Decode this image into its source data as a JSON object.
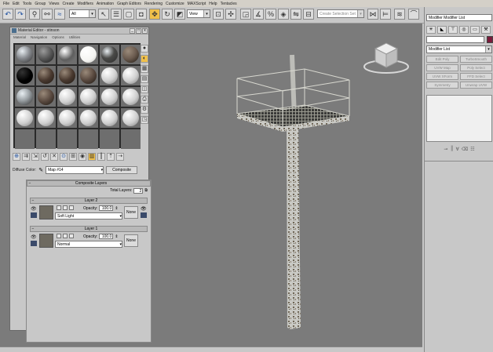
{
  "menubar": {
    "items": [
      "File",
      "Edit",
      "Tools",
      "Group",
      "Views",
      "Create",
      "Modifiers",
      "Animation",
      "Graph Editors",
      "Rendering",
      "Customize",
      "MAXScript",
      "Help",
      "Tentacles"
    ]
  },
  "toolbar": {
    "filter_value": "All",
    "ref_coord_value": "View",
    "selection_set_placeholder": "Create Selection Set",
    "icons": [
      "undo-icon",
      "redo-icon",
      "link-icon",
      "unlink-icon",
      "bind-spacewarp-icon",
      "select-object-icon",
      "select-by-name-icon",
      "rect-selection-icon",
      "window-crossing-icon",
      "move-icon",
      "rotate-icon",
      "scale-icon",
      "pivot-icon",
      "select-manipulate-icon",
      "snaps-icon",
      "angle-snap-icon",
      "percent-snap-icon",
      "spinner-snap-icon",
      "mirror-icon",
      "align-icon",
      "layers-icon",
      "curve-editor-icon"
    ]
  },
  "material_editor": {
    "title": "Material Editor - stinson",
    "menu": [
      "Material",
      "Navigation",
      "Options",
      "Utilities"
    ],
    "window_buttons": [
      "_",
      "□",
      "x"
    ],
    "diffuse_label": "Diffuse Color:",
    "map_name": "Map #14",
    "map_type": "Composite",
    "rollout_title": "Composite Layers",
    "total_layers_label": "Total Layers:",
    "total_layers_value": "2",
    "opacity_label": "Opacity:",
    "none_label": "None",
    "layers": [
      {
        "title": "Layer 2",
        "opacity": "100.0",
        "blend": "Soft Light"
      },
      {
        "title": "Layer 1",
        "opacity": "100.0",
        "blend": "Normal"
      }
    ],
    "sample_slots": [
      {
        "color": "#8a8d92",
        "style": "metal"
      },
      {
        "color": "#555555",
        "style": "dark"
      },
      {
        "color": "#5e5e5e",
        "style": "gray"
      },
      {
        "color": "#f5f5f2",
        "style": "white"
      },
      {
        "color": "#4a4a48",
        "style": "metal"
      },
      {
        "color": "#6a5a4e",
        "style": "rust"
      },
      {
        "color": "#000000",
        "style": "black"
      },
      {
        "color": "#4a3a30",
        "style": "rust"
      },
      {
        "color": "#4a3a30",
        "style": "rust"
      },
      {
        "color": "#5a4a40",
        "style": "rust"
      },
      {
        "color": "#cfcfcf",
        "style": "gray"
      },
      {
        "color": "#cfcfcf",
        "style": "gray"
      },
      {
        "color": "#9aa0a4",
        "style": "metal"
      },
      {
        "color": "#5a4a40",
        "style": "rust"
      },
      {
        "color": "#cfcfcf",
        "style": "gray"
      },
      {
        "color": "#cfcfcf",
        "style": "gray"
      },
      {
        "color": "#cfcfcf",
        "style": "gray"
      },
      {
        "color": "#cfcfcf",
        "style": "gray"
      },
      {
        "color": "#cfcfcf",
        "style": "gray"
      },
      {
        "color": "#cfcfcf",
        "style": "gray"
      },
      {
        "color": "#cfcfcf",
        "style": "gray"
      },
      {
        "color": "#cfcfcf",
        "style": "gray"
      },
      {
        "color": "#cfcfcf",
        "style": "gray"
      },
      {
        "color": "#cfcfcf",
        "style": "gray"
      },
      {
        "color": "#6e6e6e",
        "style": "empty"
      },
      {
        "color": "#6e6e6e",
        "style": "empty"
      },
      {
        "color": "#6e6e6e",
        "style": "empty"
      },
      {
        "color": "#6e6e6e",
        "style": "empty"
      },
      {
        "color": "#6e6e6e",
        "style": "empty"
      },
      {
        "color": "#6e6e6e",
        "style": "empty"
      }
    ]
  },
  "command_panel": {
    "modifier_list_field": "Modifier Modifier List",
    "modifier_dropdown": "Modifier List",
    "modifier_buttons": [
      "Edit Poly",
      "TurboSmooth",
      "UVW Map",
      "Poly Select",
      "UVW XForm",
      "FFD Select",
      "Symmetry",
      "Unwrap UVW"
    ],
    "object_color": "#7a1a3a"
  },
  "viewport": {
    "background": "#7b7b7b"
  }
}
